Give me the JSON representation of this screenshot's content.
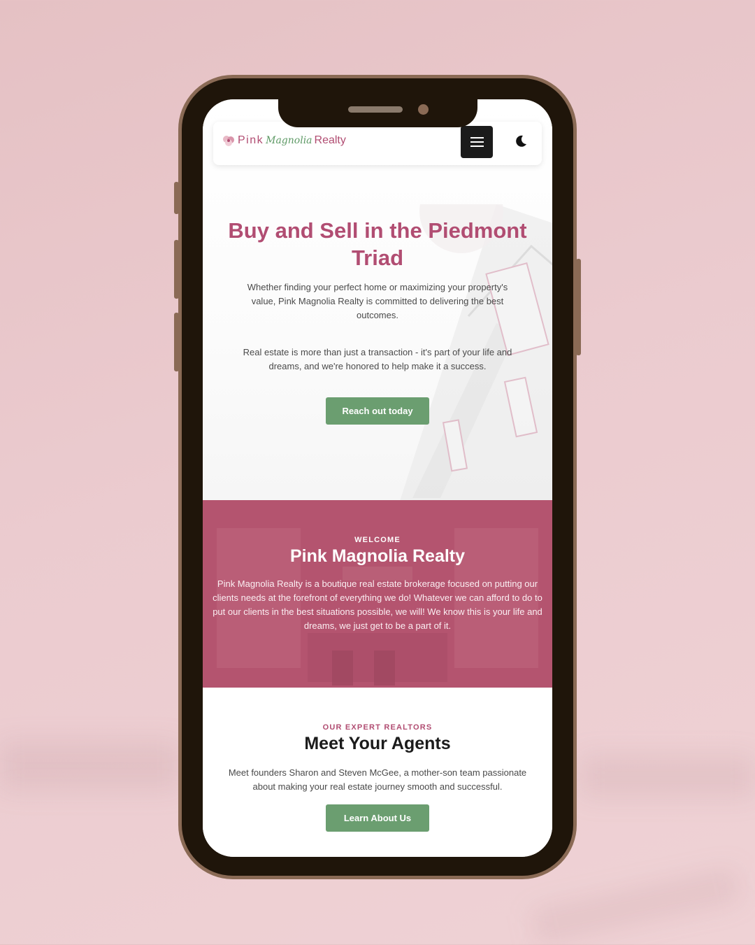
{
  "nav": {
    "logo_pink": "Pink",
    "logo_magnolia": "Magnolia",
    "logo_realty": "Realty",
    "menu_icon": "hamburger-icon",
    "theme_icon": "moon-icon"
  },
  "hero": {
    "title": "Buy and Sell in the Piedmont Triad",
    "paragraph1": "Whether finding your perfect home or maximizing your property's value, Pink Magnolia Realty is committed to delivering the best outcomes.",
    "paragraph2": "Real estate is more than just a transaction - it's part of your life and dreams, and we're honored to help make it a success.",
    "cta_label": "Reach out today"
  },
  "welcome": {
    "eyebrow": "WELCOME",
    "title": "Pink Magnolia Realty",
    "text": "Pink Magnolia Realty is a boutique real estate brokerage focused on putting our clients needs at the forefront of everything we do! Whatever we can afford to do to put our clients in the best situations possible, we will! We know this is your life and dreams, we just get to be a part of it."
  },
  "agents": {
    "eyebrow": "OUR EXPERT REALTORS",
    "title": "Meet Your Agents",
    "text": "Meet founders Sharon and Steven McGee, a mother-son team passionate about making your real estate journey smooth and successful.",
    "cta_label": "Learn About Us"
  },
  "colors": {
    "brand_pink": "#b14d72",
    "brand_green": "#6b9e70",
    "welcome_bg": "#b6566f",
    "background": "#ebcbcf",
    "phone_frame": "#1f150a",
    "phone_bezel": "#8a6a55"
  }
}
